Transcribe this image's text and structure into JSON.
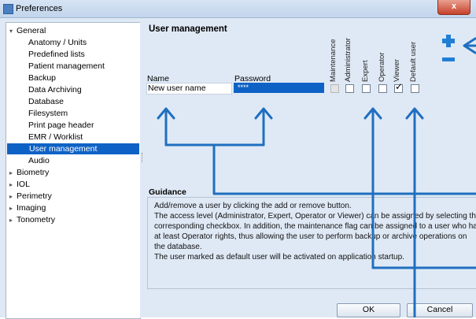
{
  "window": {
    "title": "Preferences",
    "close_label": "x"
  },
  "tree": {
    "items": [
      {
        "label": "General",
        "expander": "▾"
      },
      {
        "label": "Anatomy / Units"
      },
      {
        "label": "Predefined lists"
      },
      {
        "label": "Patient management"
      },
      {
        "label": "Backup"
      },
      {
        "label": "Data Archiving"
      },
      {
        "label": "Database"
      },
      {
        "label": "Filesystem"
      },
      {
        "label": "Print page header"
      },
      {
        "label": "EMR / Worklist"
      },
      {
        "label": "User management",
        "selected": true
      },
      {
        "label": "Audio"
      },
      {
        "label": "Biometry",
        "expander": "▸"
      },
      {
        "label": "IOL",
        "expander": "▸"
      },
      {
        "label": "Perimetry",
        "expander": "▸"
      },
      {
        "label": "Imaging",
        "expander": "▸"
      },
      {
        "label": "Tonometry",
        "expander": "▸"
      }
    ]
  },
  "user_management": {
    "title": "User management",
    "col_name": "Name",
    "col_password": "Password",
    "roles": [
      "Maintenance",
      "Administrator",
      "Expert",
      "Operator",
      "Viewer",
      "Default user"
    ],
    "row": {
      "name": "New user name",
      "password": "****",
      "checked": [
        false,
        false,
        false,
        false,
        true,
        false
      ],
      "disabled": [
        true,
        false,
        false,
        false,
        false,
        false
      ]
    }
  },
  "guidance": {
    "title": "Guidance",
    "lines": [
      "Add/remove a user by clicking the add or remove button.",
      "The access level (Administrator, Expert, Operator or Viewer) can be assigned by selecting the",
      "corresponding checkbox. In addition, the maintenance flag can be assigned to a user who has",
      "at least Operator rights, thus allowing the user to perform backup or archive operations on",
      "the database.",
      "The user marked as default user will be activated on application startup."
    ]
  },
  "buttons": {
    "ok": "OK",
    "cancel": "Cancel"
  },
  "colors": {
    "selection": "#0f62c5",
    "annotation_arrow": "#1f6fc0",
    "add_remove": "#1f7fd4"
  }
}
